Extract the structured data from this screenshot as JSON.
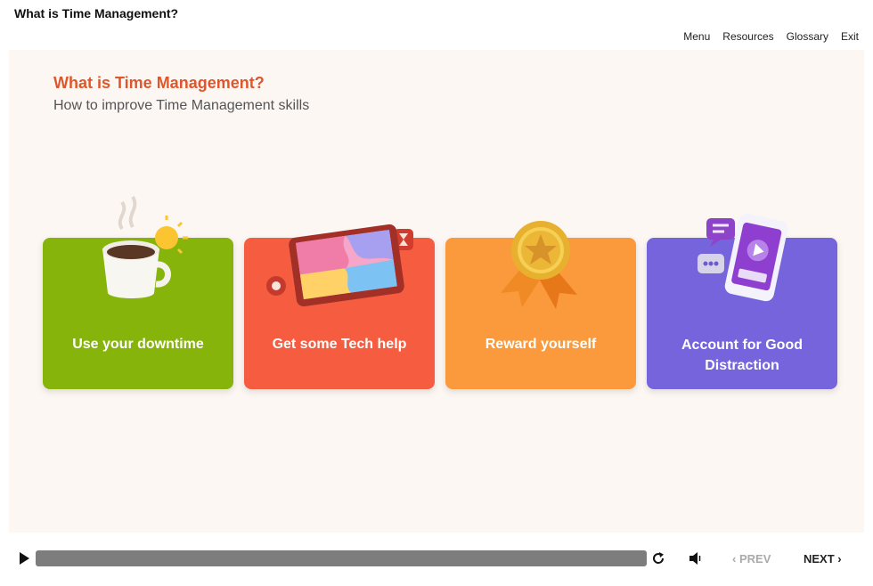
{
  "window": {
    "title": "What is Time Management?"
  },
  "nav": {
    "menu": "Menu",
    "resources": "Resources",
    "glossary": "Glossary",
    "exit": "Exit"
  },
  "slide": {
    "heading": "What is Time Management?",
    "subheading": "How to improve Time Management skills",
    "cards": [
      {
        "label": "Use your downtime",
        "color": "#86b40b",
        "icon": "coffee-cup-sun-icon"
      },
      {
        "label": "Get some Tech help",
        "color": "#f65d40",
        "icon": "tablet-puzzle-icon"
      },
      {
        "label": "Reward yourself",
        "color": "#fa9a3d",
        "icon": "medal-badge-icon"
      },
      {
        "label": "Account for Good Distraction",
        "color": "#7564dc",
        "icon": "smartphone-chat-icon"
      }
    ]
  },
  "player": {
    "play_icon": "play-icon",
    "replay_icon": "replay-icon",
    "volume_icon": "volume-icon",
    "prev_label": "PREV",
    "next_label": "NEXT",
    "prev_glyph": "‹",
    "next_glyph": "›"
  }
}
